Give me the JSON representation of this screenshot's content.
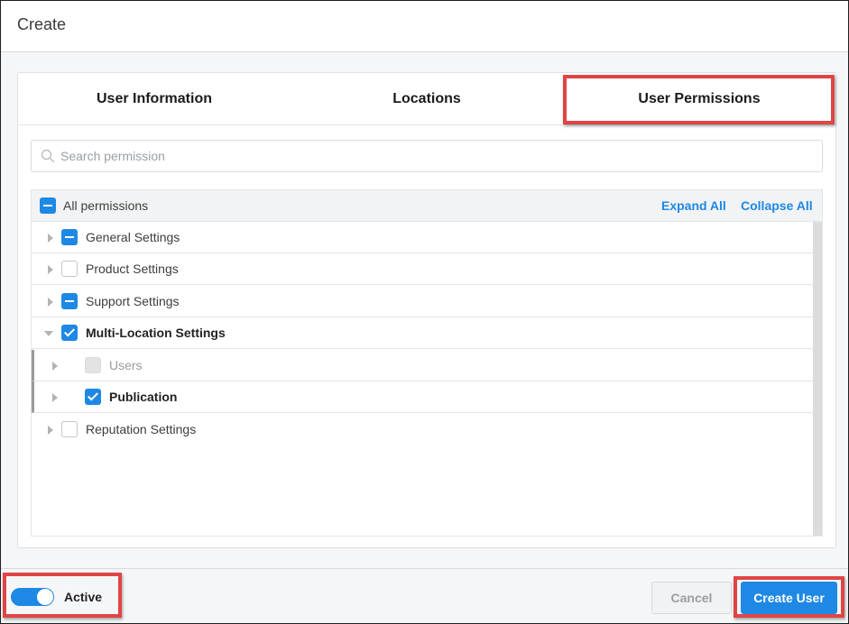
{
  "dialog": {
    "title": "Create"
  },
  "tabs": [
    {
      "label": "User Information"
    },
    {
      "label": "Locations"
    },
    {
      "label": "User Permissions",
      "selected": true
    }
  ],
  "search": {
    "placeholder": "Search permission",
    "value": ""
  },
  "tree": {
    "all_label": "All permissions",
    "all_state": "partial",
    "expand_all": "Expand All",
    "collapse_all": "Collapse All",
    "rows": [
      {
        "label": "General Settings",
        "state": "partial",
        "expanded": false
      },
      {
        "label": "Product Settings",
        "state": "unchecked",
        "expanded": false
      },
      {
        "label": "Support Settings",
        "state": "partial",
        "expanded": false
      },
      {
        "label": "Multi-Location Settings",
        "state": "checked",
        "expanded": true,
        "children": [
          {
            "label": "Users",
            "state": "disabled"
          },
          {
            "label": "Publication",
            "state": "checked"
          }
        ]
      },
      {
        "label": "Reputation Settings",
        "state": "unchecked",
        "expanded": false
      }
    ]
  },
  "footer": {
    "active_label": "Active",
    "active_on": true,
    "cancel_label": "Cancel",
    "create_label": "Create User"
  },
  "colors": {
    "accent": "#1e88e5",
    "highlight": "#e04545"
  }
}
